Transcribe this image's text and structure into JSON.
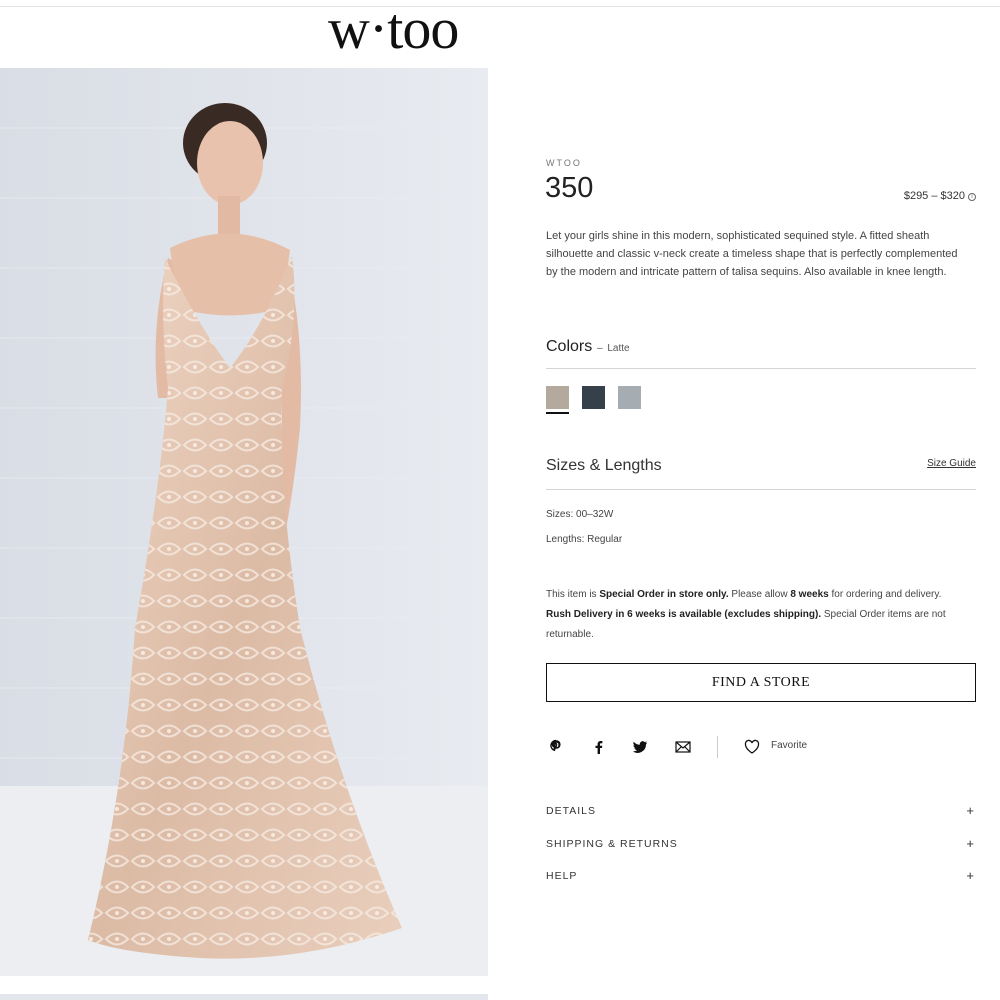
{
  "header": {
    "logo": "w·too"
  },
  "product": {
    "brand": "WTOO",
    "style_number": "350",
    "price": "$295 – $320",
    "price_info_icon": "info-icon",
    "description": "Let your girls shine in this modern, sophisticated sequined style. A fitted sheath silhouette and classic v-neck create a timeless shape that is perfectly complemented by the modern and intricate pattern of talisa sequins. Also available in knee length."
  },
  "colors": {
    "heading": "Colors",
    "separator": " – ",
    "selected": "Latte",
    "swatches": [
      {
        "name": "Latte",
        "hex": "#b3a99c",
        "active": true
      },
      {
        "name": "Navy",
        "hex": "#36404b",
        "active": false
      },
      {
        "name": "Silver",
        "hex": "#a5acb2",
        "active": false
      }
    ]
  },
  "sizes": {
    "heading": "Sizes & Lengths",
    "size_guide": "Size Guide",
    "sizes_line": "Sizes: 00–32W",
    "lengths_line": "Lengths: Regular"
  },
  "notice": {
    "t1": "This item is ",
    "b1": "Special Order in store only.",
    "t2": " Please allow ",
    "b2": "8 weeks",
    "t3": " for ordering and delivery. ",
    "b3": "Rush Delivery in 6 weeks is available (excludes shipping).",
    "t4": " Special Order items are not returnable."
  },
  "cta": {
    "find_store": "FIND A STORE"
  },
  "share": {
    "icons": [
      "pinterest-icon",
      "facebook-icon",
      "twitter-icon",
      "email-icon",
      "heart-icon"
    ],
    "favorite": "Favorite"
  },
  "accordion": [
    {
      "label": "DETAILS",
      "icon": "+"
    },
    {
      "label": "SHIPPING & RETURNS",
      "icon": "+"
    },
    {
      "label": "HELP",
      "icon": "+"
    }
  ],
  "colors_theme": {
    "accent": "#111111",
    "rule": "#d4d4d4",
    "photo_bg": "#dfe3ea",
    "dress": "#e6c9b4"
  }
}
